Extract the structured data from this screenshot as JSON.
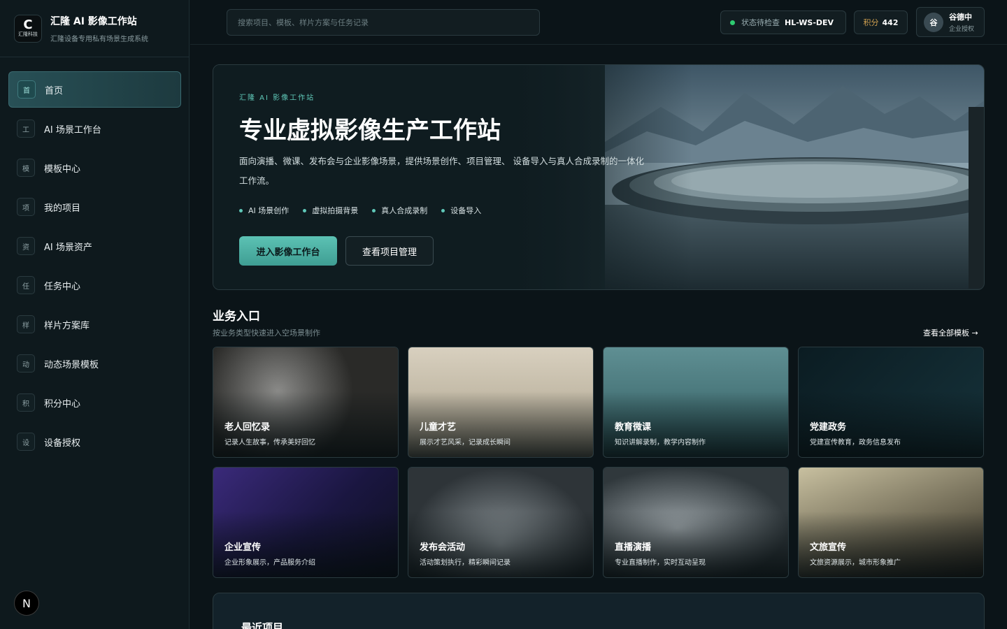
{
  "brand": {
    "logo_glyph": "C",
    "logo_text": "汇隆科技",
    "title": "汇隆 AI 影像工作站",
    "subtitle": "汇隆设备专用私有场景生成系统"
  },
  "nav": [
    {
      "icon": "首",
      "label": "首页",
      "active": true
    },
    {
      "icon": "工",
      "label": "AI 场景工作台"
    },
    {
      "icon": "模",
      "label": "模板中心"
    },
    {
      "icon": "项",
      "label": "我的项目"
    },
    {
      "icon": "资",
      "label": "AI 场景资产"
    },
    {
      "icon": "任",
      "label": "任务中心"
    },
    {
      "icon": "样",
      "label": "样片方案库"
    },
    {
      "icon": "动",
      "label": "动态场景模板"
    },
    {
      "icon": "积",
      "label": "积分中心"
    },
    {
      "icon": "设",
      "label": "设备授权"
    }
  ],
  "corner_badge": "N",
  "search": {
    "placeholder": "搜索项目、模板、样片方案与任务记录"
  },
  "status": {
    "label": "状态待检查",
    "device": "HL-WS-DEV",
    "dot_color": "#2ecc71"
  },
  "points": {
    "label": "积分",
    "value": "442"
  },
  "user": {
    "avatar": "谷",
    "name": "谷德中",
    "role": "企业授权"
  },
  "hero": {
    "eyebrow": "汇隆 AI 影像工作站",
    "title": "专业虚拟影像生产工作站",
    "description": "面向演播、微课、发布会与企业影像场景，提供场景创作、项目管理、 设备导入与真人合成录制的一体化工作流。",
    "tags": [
      "AI 场景创作",
      "虚拟拍摄背景",
      "真人合成录制",
      "设备导入"
    ],
    "primary_button": "进入影像工作台",
    "secondary_button": "查看项目管理"
  },
  "section": {
    "title": "业务入口",
    "subtitle": "按业务类型快速进入空场景制作",
    "link": "查看全部模板 →"
  },
  "cards": [
    {
      "title": "老人回忆录",
      "desc": "记录人生故事，传承美好回忆",
      "bg": "old-tv"
    },
    {
      "title": "儿童才艺",
      "desc": "展示才艺风采，记录成长瞬间",
      "bg": "ink-painting"
    },
    {
      "title": "教育微课",
      "desc": "知识讲解录制，教学内容制作",
      "bg": "teacher"
    },
    {
      "title": "党建政务",
      "desc": "党建宣传教育，政务信息发布",
      "bg": "code"
    },
    {
      "title": "企业宣传",
      "desc": "企业形象展示，产品服务介绍",
      "bg": "dj"
    },
    {
      "title": "发布会活动",
      "desc": "活动策划执行，精彩瞬间记录",
      "bg": "studio"
    },
    {
      "title": "直播演播",
      "desc": "专业直播制作，实时互动呈现",
      "bg": "studio2"
    },
    {
      "title": "文旅宣传",
      "desc": "文旅资源展示，城市形象推广",
      "bg": "pavilion"
    }
  ],
  "recent": {
    "title": "最近项目"
  }
}
